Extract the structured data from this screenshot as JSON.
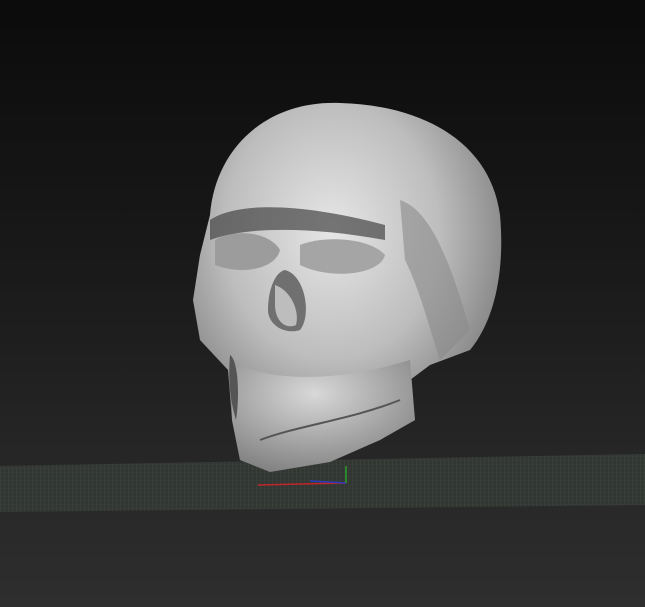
{
  "viewport": {
    "object": "skull-mesh",
    "background_top": "#0b0b0b",
    "background_bottom": "#2e2e2e",
    "floor_grid_color": "#4a544a",
    "axis_colors": {
      "x": "#c0262a",
      "y": "#2aa02a",
      "z": "#2a3ac0"
    }
  }
}
